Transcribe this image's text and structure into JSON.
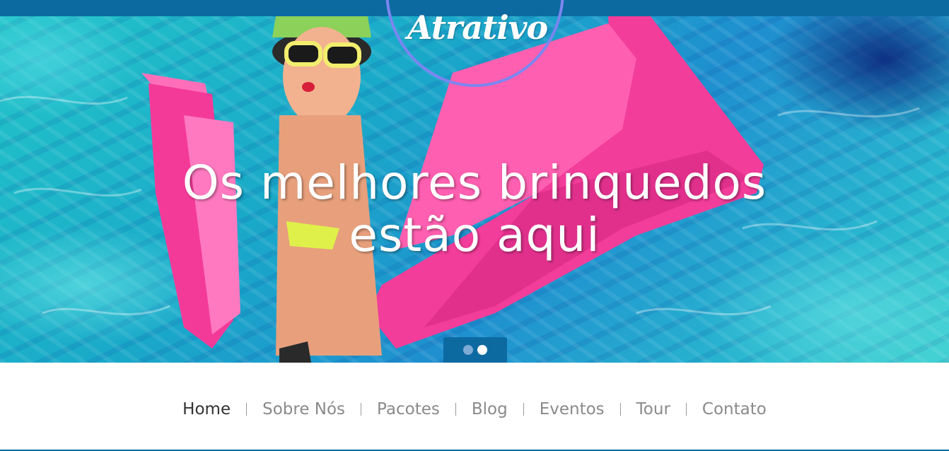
{
  "colors": {
    "brand": "#0d6aa1",
    "logo_ring": "#7b86f0",
    "pool": "#22c4c9",
    "float_pink": "#f23d9a",
    "nav_text": "#8a8a8a",
    "nav_active": "#333333"
  },
  "logo": {
    "text": "Atrativo"
  },
  "hero": {
    "headline_line1": "Os melhores brinquedos",
    "headline_line2": "estão aqui",
    "image": "woman-on-pink-pool-float",
    "slides_total": 2,
    "active_slide": 2
  },
  "nav": {
    "items": [
      {
        "label": "Home",
        "active": true
      },
      {
        "label": "Sobre Nós"
      },
      {
        "label": "Pacotes"
      },
      {
        "label": "Blog"
      },
      {
        "label": "Eventos"
      },
      {
        "label": "Tour"
      },
      {
        "label": "Contato"
      }
    ]
  }
}
